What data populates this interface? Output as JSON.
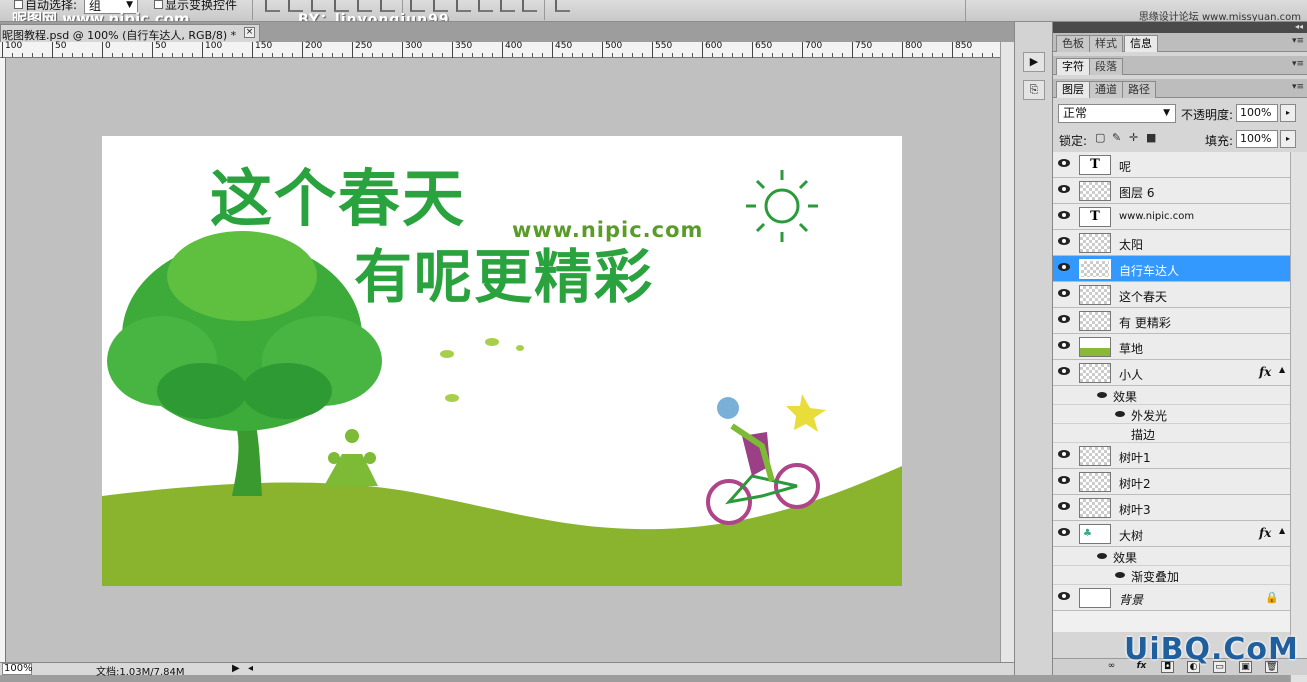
{
  "options_bar": {
    "auto_select_label": "自动选择:",
    "auto_select_value": "组",
    "show_transform_label": "显示变换控件",
    "watermark": "昵图网 www.nipic.com",
    "credit": "BY：linyongjun99",
    "site_watermark": "思缘设计论坛 www.missyuan.com"
  },
  "document": {
    "tab_title": "昵图教程.psd @ 100% (自行车达人, RGB/8) *",
    "close_label": "×",
    "ruler_ticks": [
      "100",
      "50",
      "0",
      "50",
      "100",
      "150",
      "200",
      "250",
      "300",
      "350",
      "400",
      "450",
      "500",
      "550",
      "600",
      "650",
      "700",
      "750",
      "800",
      "850"
    ],
    "zoom": "100%",
    "doc_size": "文档:1.03M/7.84M"
  },
  "artwork": {
    "title_line1": "这个春天",
    "title_line2": "有呢更精彩",
    "url": "www.nipic.com",
    "colors": {
      "green": "#2aa33f",
      "grass": "#8ab42e",
      "bike": "#b0448a"
    }
  },
  "panels": {
    "row1_tabs": [
      "色板",
      "样式",
      "信息"
    ],
    "row2_tabs": [
      "字符",
      "段落"
    ],
    "row3_tabs": [
      "图层",
      "通道",
      "路径"
    ],
    "blend_mode": "正常",
    "opacity_label": "不透明度:",
    "opacity_value": "100%",
    "lock_label": "锁定:",
    "fill_label": "填充:",
    "fill_value": "100%",
    "menu_glyph": "▾≡"
  },
  "layers": [
    {
      "name": "呢",
      "thumb": "text"
    },
    {
      "name": "图层 6",
      "thumb": "transparent"
    },
    {
      "name": "www.nipic.com",
      "thumb": "text"
    },
    {
      "name": "太阳",
      "thumb": "transparent"
    },
    {
      "name": "自行车达人",
      "thumb": "transparent",
      "selected": true
    },
    {
      "name": "这个春天",
      "thumb": "transparent"
    },
    {
      "name": "有 更精彩",
      "thumb": "transparent"
    },
    {
      "name": "草地",
      "thumb": "grass"
    },
    {
      "name": "小人",
      "thumb": "transparent",
      "fx": true,
      "effects": [
        "效果",
        "外发光",
        "描边"
      ]
    },
    {
      "name": "树叶1",
      "thumb": "transparent"
    },
    {
      "name": "树叶2",
      "thumb": "transparent"
    },
    {
      "name": "树叶3",
      "thumb": "transparent"
    },
    {
      "name": "大树",
      "thumb": "tree",
      "fx": true,
      "effects": [
        "效果",
        "渐变叠加"
      ]
    },
    {
      "name": "背景",
      "thumb": "white",
      "locked": true
    }
  ],
  "fx_label": "fx",
  "corner_watermark": "UiBQ.CoM"
}
